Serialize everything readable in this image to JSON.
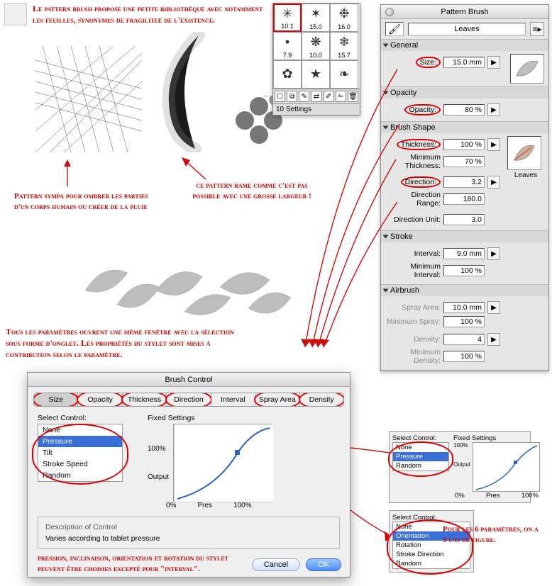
{
  "annotations": {
    "topleft": "Le pattern brush propose une petite bibliothèque avec notamment les feuilles, synonymes de fragiliteé de l'existence.",
    "caption_left": "Pattern sympa pour ombrer les parties d'un corps humain ou créer de la pluie",
    "caption_right": "ce pattern rame comme c'est pas possible avec une grosse largeur !",
    "mid": "Tous les paramètres ouvrent une même fenêtre avec la sélection sous forme d'onglet. Les propriétés du stylet sont mises à contribution selon le paramètre.",
    "dlg_note": "pression, inclinaison, orientation et rotation du stylet peuvent être choisies excepté pour \"interval\".",
    "right_note": "Pour les 6 paramètres, on a 3 cas de figure."
  },
  "picker": {
    "cells": [
      {
        "v": "10.1",
        "g": "✳"
      },
      {
        "v": "15.0",
        "g": "✶"
      },
      {
        "v": "16.0",
        "g": "❉"
      },
      {
        "v": "7.9",
        "g": "•"
      },
      {
        "v": "10.0",
        "g": "❋"
      },
      {
        "v": "15.7",
        "g": "❄"
      },
      {
        "v": "",
        "g": "✿"
      },
      {
        "v": "",
        "g": "★"
      },
      {
        "v": "",
        "g": "❧"
      }
    ],
    "selected_index": 0,
    "footer": "10 Settings"
  },
  "panel": {
    "title": "Pattern Brush",
    "brush_name": "Leaves",
    "sections": {
      "general": {
        "title": "General",
        "size": {
          "label": "Size:",
          "value": "15.0 mm"
        }
      },
      "opacity": {
        "title": "Opacity",
        "opacity": {
          "label": "Opacity:",
          "value": "80 %"
        }
      },
      "brush_shape": {
        "title": "Brush Shape",
        "thickness": {
          "label": "Thickness:",
          "value": "100 %"
        },
        "min_thickness": {
          "label": "Minimum Thickness:",
          "value": "70 %"
        },
        "direction": {
          "label": "Direction:",
          "value": "3.2"
        },
        "direction_range": {
          "label": "Direction Range:",
          "value": "180.0"
        },
        "direction_unit": {
          "label": "Direction Unit:",
          "value": "3.0"
        },
        "preview_label": "Leaves"
      },
      "stroke": {
        "title": "Stroke",
        "interval": {
          "label": "Interval:",
          "value": "9.0 mm"
        },
        "min_interval": {
          "label": "Minimum Interval:",
          "value": "100 %"
        }
      },
      "airbrush": {
        "title": "Airbrush",
        "spray_area": {
          "label": "Spray Area:",
          "value": "10.0 mm"
        },
        "min_spray": {
          "label": "Minimum Spray:",
          "value": "100 %"
        },
        "density": {
          "label": "Density:",
          "value": "4"
        },
        "min_density": {
          "label": "Minimum Density:",
          "value": "100 %"
        }
      }
    }
  },
  "dialog": {
    "title": "Brush Control",
    "tabs": [
      "Size",
      "Opacity",
      "Thickness",
      "Direction",
      "Interval",
      "Spray Area",
      "Density"
    ],
    "selected_tab": 0,
    "select_label": "Select Control:",
    "options": [
      "None",
      "Pressure",
      "Tilt",
      "Stroke Speed",
      "Random"
    ],
    "selected_option": 1,
    "fixed_label": "Fixed Settings",
    "output_label": "Output",
    "axis_left": "0%",
    "axis_mid": "Pres",
    "axis_right": "100%",
    "desc_label": "Description of Control",
    "desc_text": "Varies according to tablet pressure",
    "cancel": "Cancel",
    "ok": "OK"
  },
  "mini1": {
    "select_label": "Select Control:",
    "options": [
      "None",
      "Pressure",
      "Random"
    ],
    "selected": 1,
    "fixed_label": "Fixed Settings",
    "y100": "100%",
    "output": "Output",
    "axis_left": "0%",
    "axis_mid": "Pres",
    "axis_right": "100%"
  },
  "mini2": {
    "select_label": "Select Control:",
    "options": [
      "None",
      "Orientation",
      "Rotation",
      "Stroke Direction",
      "Random"
    ],
    "selected": 1
  }
}
